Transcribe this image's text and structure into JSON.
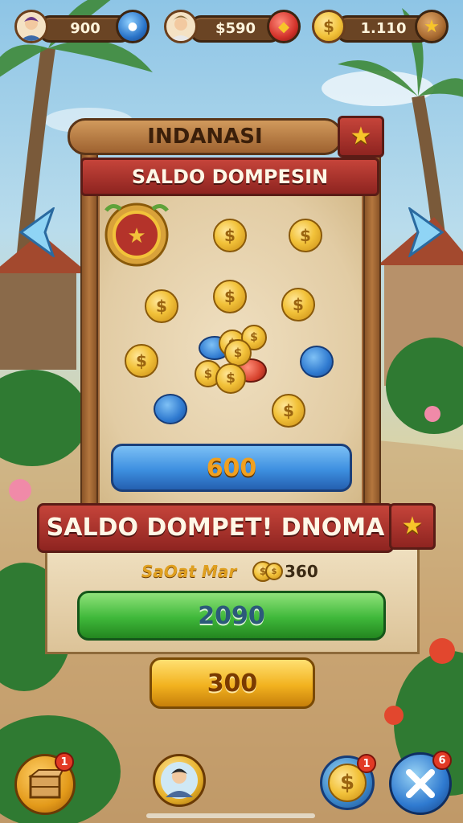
{
  "top_bar": {
    "stat1_value": "900",
    "stat2_value": "$590",
    "stat3_value": "1.110"
  },
  "panel": {
    "title": "INDANASI",
    "subtitle": "SALDO DOMPESIN",
    "blue_bar_value": "600"
  },
  "wallet": {
    "banner": "SALDO DOMPET! DNOMA",
    "info_label": "SaOat Mar",
    "info_value": "360",
    "green_bar_value": "2090"
  },
  "yellow_button_value": "300",
  "icons": {
    "shop": "crate-icon",
    "profile": "avatar-icon",
    "coin_action": "dollar-coin-icon",
    "close": "close-icon"
  },
  "badges": {
    "shop": "1",
    "coin": "1",
    "close": "6"
  },
  "colors": {
    "wood": "#a2693a",
    "banner_red": "#a8302a",
    "blue_bar": "#3d8fe0",
    "green_bar": "#3fb83a",
    "yellow_bar": "#f2b21f",
    "gold_text": "#f0a020"
  }
}
